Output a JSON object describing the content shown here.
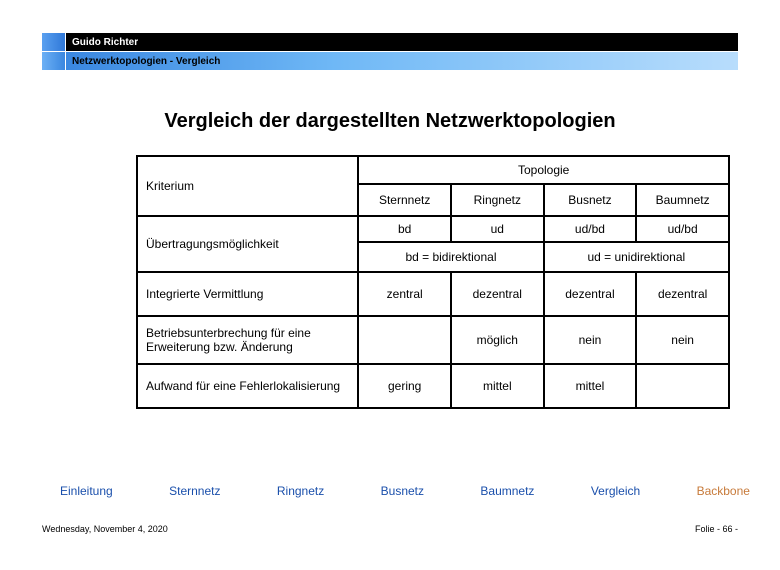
{
  "header": {
    "author": "Guido Richter",
    "subtitle": "Netzwerktopologien  - Vergleich"
  },
  "title": "Vergleich der dargestellten Netzwerktopologien",
  "chart_data": {
    "type": "table",
    "header": {
      "criterion": "Kriterium",
      "group": "Topologie",
      "columns": [
        "Sternnetz",
        "Ringnetz",
        "Busnetz",
        "Baumnetz"
      ]
    },
    "rows": [
      {
        "label": "Übertragungsmöglichkeit",
        "line1": [
          "bd",
          "ud",
          "ud/bd",
          "ud/bd"
        ],
        "legend": {
          "left": "bd = bidirektional",
          "right": "ud = unidirektional"
        }
      },
      {
        "label": "Integrierte Vermittlung",
        "cells": [
          "zentral",
          "dezentral",
          "dezentral",
          "dezentral"
        ]
      },
      {
        "label": "Betriebsunterbrechung für eine Erweiterung bzw. Änderung",
        "cells": [
          "",
          "möglich",
          "nein",
          "nein"
        ]
      },
      {
        "label": "Aufwand für eine Fehlerlokalisierung",
        "cells": [
          "gering",
          "mittel",
          "mittel",
          ""
        ]
      }
    ]
  },
  "nav": {
    "items": [
      "Einleitung",
      "Sternnetz",
      "Ringnetz",
      "Busnetz",
      "Baumnetz",
      "Vergleich",
      "Backbone"
    ]
  },
  "footer": {
    "date": "Wednesday, November 4, 2020",
    "page": "Folie - 66 -"
  }
}
